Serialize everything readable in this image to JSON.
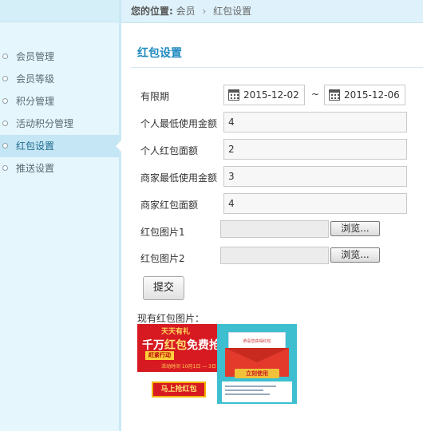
{
  "breadcrumb": {
    "label": "您的位置:",
    "items": [
      "会员",
      "红包设置"
    ],
    "separator": "›"
  },
  "sidebar": {
    "items": [
      {
        "label": "会员管理"
      },
      {
        "label": "会员等级"
      },
      {
        "label": "积分管理"
      },
      {
        "label": "活动积分管理"
      },
      {
        "label": "红包设置",
        "active": true
      },
      {
        "label": "推送设置"
      }
    ]
  },
  "page": {
    "title": "红包设置"
  },
  "form": {
    "validity": {
      "label": "有限期",
      "start": "2015-12-02",
      "separator": "~",
      "end": "2015-12-06"
    },
    "personal_min": {
      "label": "个人最低使用金额",
      "value": "4"
    },
    "personal_amount": {
      "label": "个人红包面额",
      "value": "2"
    },
    "merchant_min": {
      "label": "商家最低使用金额",
      "value": "3"
    },
    "merchant_amount": {
      "label": "商家红包面额",
      "value": "4"
    },
    "image1": {
      "label": "红包图片1",
      "browse": "浏览..."
    },
    "image2": {
      "label": "红包图片2",
      "browse": "浏览..."
    },
    "submit": "提交"
  },
  "existing": {
    "label": "现有红包图片：",
    "image1": {
      "line1": "天天有礼",
      "line2a": "千万",
      "line2b": "红包",
      "line2c": "免费抢",
      "tag": "赶紧行动",
      "date": "活动时间 10月1日 — 3日",
      "badge": "马上抢红包"
    },
    "image2": {
      "header": "恭喜您获得红包",
      "button": "立刻使用"
    }
  },
  "colors": {
    "accent": "#1f8ac0",
    "sidebar_bg": "#e6f6fd",
    "active_bg": "#c5e6f4"
  }
}
